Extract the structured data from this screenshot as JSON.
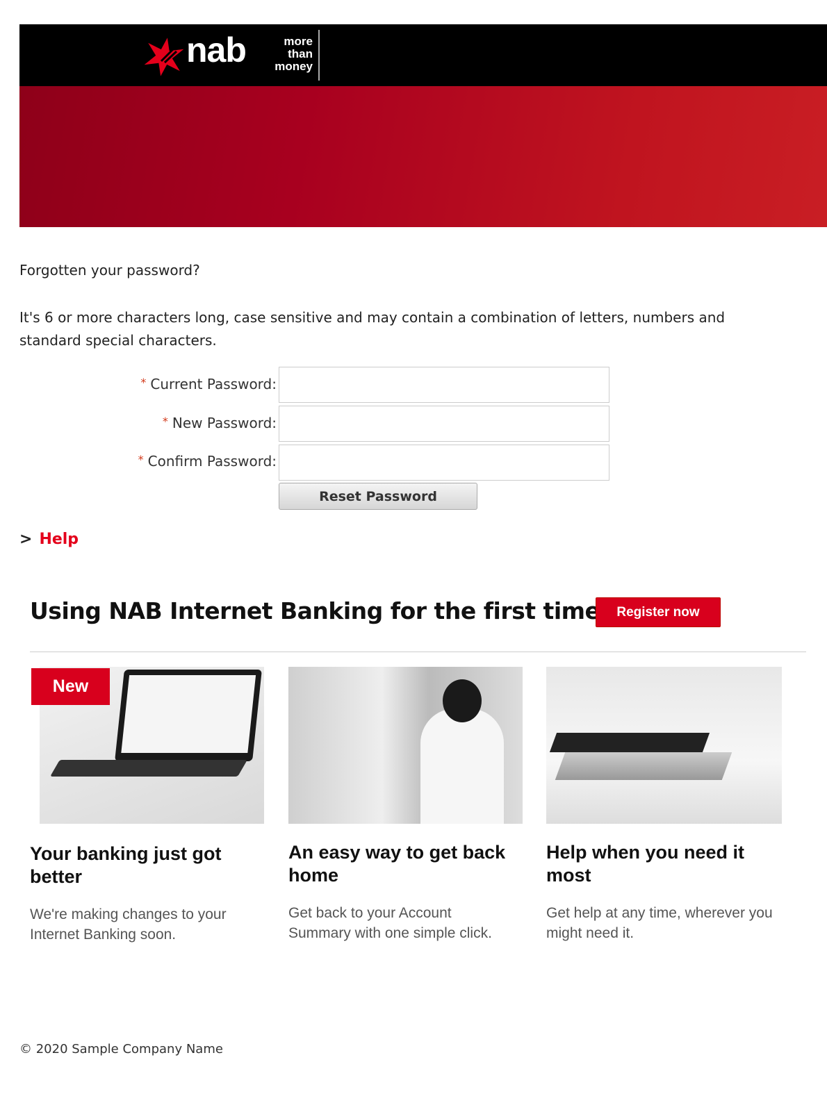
{
  "header": {
    "brand": "nab",
    "tagline": [
      "more",
      "than",
      "money"
    ]
  },
  "form": {
    "title": "Forgotten your password?",
    "hint": "It's 6 or more characters long, case sensitive and may contain a combination of letters, numbers and standard special characters.",
    "required_mark": "*",
    "fields": [
      {
        "label": "Current Password:",
        "value": ""
      },
      {
        "label": "New Password:",
        "value": ""
      },
      {
        "label": "Confirm Password:",
        "value": ""
      }
    ],
    "submit": "Reset Password"
  },
  "help": {
    "chevron": ">",
    "label": "Help"
  },
  "promo": {
    "heading": "Using NAB Internet Banking for the first time?",
    "register": "Register now",
    "badge": "New",
    "cards": [
      {
        "title": "Your banking just got better",
        "desc": "We're making changes to your Internet Banking soon."
      },
      {
        "title": "An easy way to get back home",
        "desc": "Get back to your Account Summary with one simple click."
      },
      {
        "title": "Help when you need it most",
        "desc": "Get help at any time, wherever you might need it."
      }
    ]
  },
  "footer": {
    "copyright": "© 2020 Sample Company Name"
  },
  "colors": {
    "brand_red": "#d8001d",
    "header": "#000000"
  }
}
